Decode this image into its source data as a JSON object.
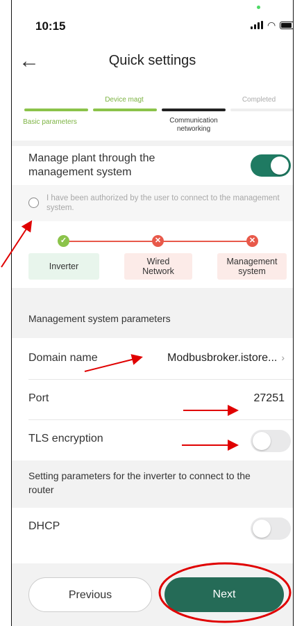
{
  "status_bar": {
    "time": "10:15"
  },
  "header": {
    "back_icon": "arrow-left-icon",
    "title": "Quick settings"
  },
  "stepper": {
    "steps": [
      {
        "label": "Basic parameters",
        "state": "done"
      },
      {
        "label": "Device magt",
        "state": "done"
      },
      {
        "label": "Communication networking",
        "state": "current"
      },
      {
        "label": "Completed",
        "state": "pending"
      }
    ]
  },
  "manage": {
    "label": "Manage plant through the management system",
    "enabled": true
  },
  "authorization": {
    "text": "I have been authorized by the user to connect to the management system.",
    "checked": false
  },
  "network": {
    "nodes": [
      {
        "label": "Inverter",
        "status": "ok"
      },
      {
        "label": "Wired Network",
        "status": "error"
      },
      {
        "label": "Management system",
        "status": "error"
      }
    ]
  },
  "management_params": {
    "section_title": "Management system parameters",
    "domain": {
      "label": "Domain name",
      "value": "Modbusbroker.istore..."
    },
    "port": {
      "label": "Port",
      "value": "27251"
    },
    "tls": {
      "label": "TLS encryption",
      "enabled": false
    }
  },
  "router_params": {
    "section_title": "Setting parameters for the inverter to connect to the router",
    "dhcp": {
      "label": "DHCP",
      "enabled": false
    }
  },
  "footer": {
    "previous_label": "Previous",
    "next_label": "Next"
  },
  "colors": {
    "accent": "#1f7a62",
    "step_done": "#8bc34a",
    "error": "#e8594a",
    "annotation": "#e00000"
  }
}
